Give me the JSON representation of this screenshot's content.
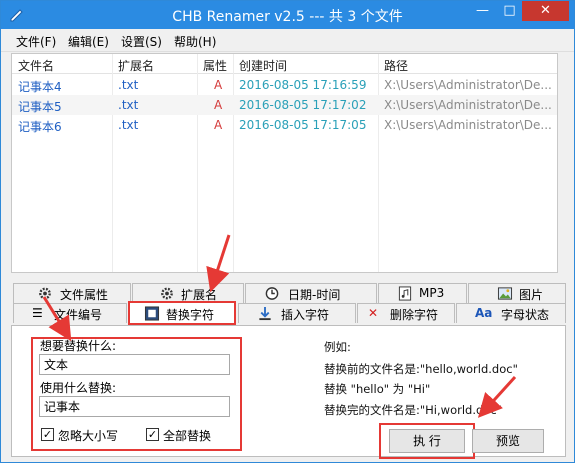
{
  "window": {
    "title": "CHB Renamer v2.5 --- 共 3 个文件",
    "min": "—",
    "max": "□",
    "close": "✕"
  },
  "menu": [
    "文件(F)",
    "编辑(E)",
    "设置(S)",
    "帮助(H)"
  ],
  "columns": [
    "文件名",
    "扩展名",
    "属性",
    "创建时间",
    "路径"
  ],
  "files": [
    {
      "name": "记事本4",
      "ext": ".txt",
      "attr": "A",
      "created": "2016-08-05 17:16:59",
      "path": "X:\\Users\\Administrator\\De..."
    },
    {
      "name": "记事本5",
      "ext": ".txt",
      "attr": "A",
      "created": "2016-08-05 17:17:02",
      "path": "X:\\Users\\Administrator\\De..."
    },
    {
      "name": "记事本6",
      "ext": ".txt",
      "attr": "A",
      "created": "2016-08-05 17:17:05",
      "path": "X:\\Users\\Administrator\\De..."
    }
  ],
  "tabs_row1": [
    "文件属性",
    "扩展名",
    "日期-时间",
    "MP3",
    "图片"
  ],
  "tabs_row2": [
    "文件编号",
    "替换字符",
    "插入字符",
    "删除字符",
    "字母状态"
  ],
  "form": {
    "find_label": "想要替换什么:",
    "find_value": "文本",
    "replace_label": "使用什么替换:",
    "replace_value": "记事本",
    "ignore_case": "忽略大小写",
    "replace_all": "全部替换"
  },
  "example": {
    "title": "例如:",
    "line1": "替换前的文件名是:\"hello,world.doc\"",
    "line2": "替换 \"hello\" 为 \"Hi\"",
    "line3": "替换完的文件名是:\"Hi,world.doc\""
  },
  "buttons": {
    "execute": "执 行",
    "preview": "预览"
  },
  "colors": {
    "titlebar": "#2b8be2",
    "highlight": "#e53935"
  }
}
